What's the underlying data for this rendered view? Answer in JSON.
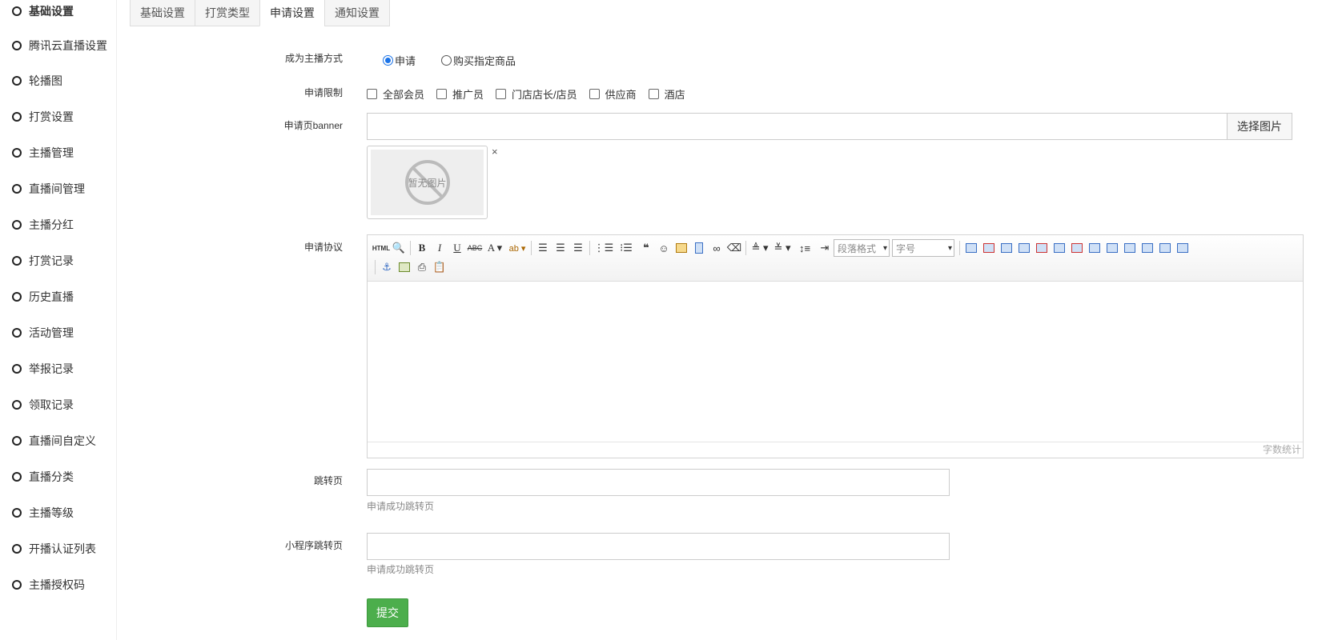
{
  "sidebar": {
    "items": [
      {
        "label": "基础设置",
        "active": true
      },
      {
        "label": "腾讯云直播设置"
      },
      {
        "label": "轮播图"
      },
      {
        "label": "打赏设置"
      },
      {
        "label": "主播管理"
      },
      {
        "label": "直播间管理"
      },
      {
        "label": "主播分红"
      },
      {
        "label": "打赏记录"
      },
      {
        "label": "历史直播"
      },
      {
        "label": "活动管理"
      },
      {
        "label": "举报记录"
      },
      {
        "label": "领取记录"
      },
      {
        "label": "直播间自定义"
      },
      {
        "label": "直播分类"
      },
      {
        "label": "主播等级"
      },
      {
        "label": "开播认证列表"
      },
      {
        "label": "主播授权码"
      }
    ]
  },
  "tabs": [
    {
      "label": "基础设置"
    },
    {
      "label": "打赏类型"
    },
    {
      "label": "申请设置",
      "active": true
    },
    {
      "label": "通知设置"
    }
  ],
  "form": {
    "become_method": {
      "label": "成为主播方式",
      "options": [
        "申请",
        "购买指定商品"
      ],
      "selected": "申请"
    },
    "apply_limit": {
      "label": "申请限制",
      "options": [
        "全部会员",
        "推广员",
        "门店店长/店员",
        "供应商",
        "酒店"
      ]
    },
    "banner": {
      "label": "申请页banner",
      "value": "",
      "pick_button": "选择图片",
      "no_image_text": "暂无图片",
      "close": "×"
    },
    "agreement": {
      "label": "申请协议",
      "paragraph_format": "段落格式",
      "font_size": "字号",
      "word_count": "字数统计"
    },
    "redirect": {
      "label": "跳转页",
      "value": "",
      "hint": "申请成功跳转页"
    },
    "mini_redirect": {
      "label": "小程序跳转页",
      "value": "",
      "hint": "申请成功跳转页"
    },
    "submit_label": "提交"
  },
  "colors": {
    "submit_bg": "#4cae4c",
    "radio_accent": "#1a73e8"
  }
}
